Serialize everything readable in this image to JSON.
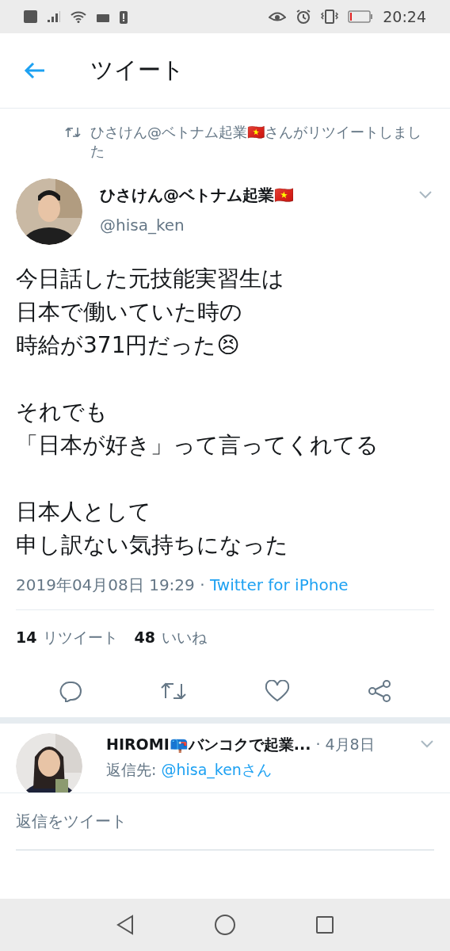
{
  "status_bar": {
    "time": "20:24"
  },
  "header": {
    "title": "ツイート"
  },
  "retweet_note": "ひさけん@ベトナム起業🇻🇳さんがリツイートしました",
  "tweet": {
    "name": "ひさけん@ベトナム起業🇻🇳",
    "handle": "@hisa_ken",
    "paragraphs": [
      [
        "今日話した元技能実習生は",
        "日本で働いていた時の",
        "時給が371円だった😣"
      ],
      [
        "それでも",
        "「日本が好き」って言ってくれてる"
      ],
      [
        "日本人として",
        "申し訳ない気持ちになった"
      ]
    ],
    "timestamp": "2019年04月08日 19:29 · ",
    "source": "Twitter for iPhone",
    "stats": [
      {
        "count": "14",
        "label": "リツイート"
      },
      {
        "count": "48",
        "label": "いいね"
      }
    ]
  },
  "reply": {
    "name": "HIROMI📪バンコクで起業...",
    "date": "· 4月8日",
    "reply_to_label": "返信先: ",
    "reply_to": "@hisa_kenさん"
  },
  "composer": {
    "placeholder": "返信をツイート"
  }
}
